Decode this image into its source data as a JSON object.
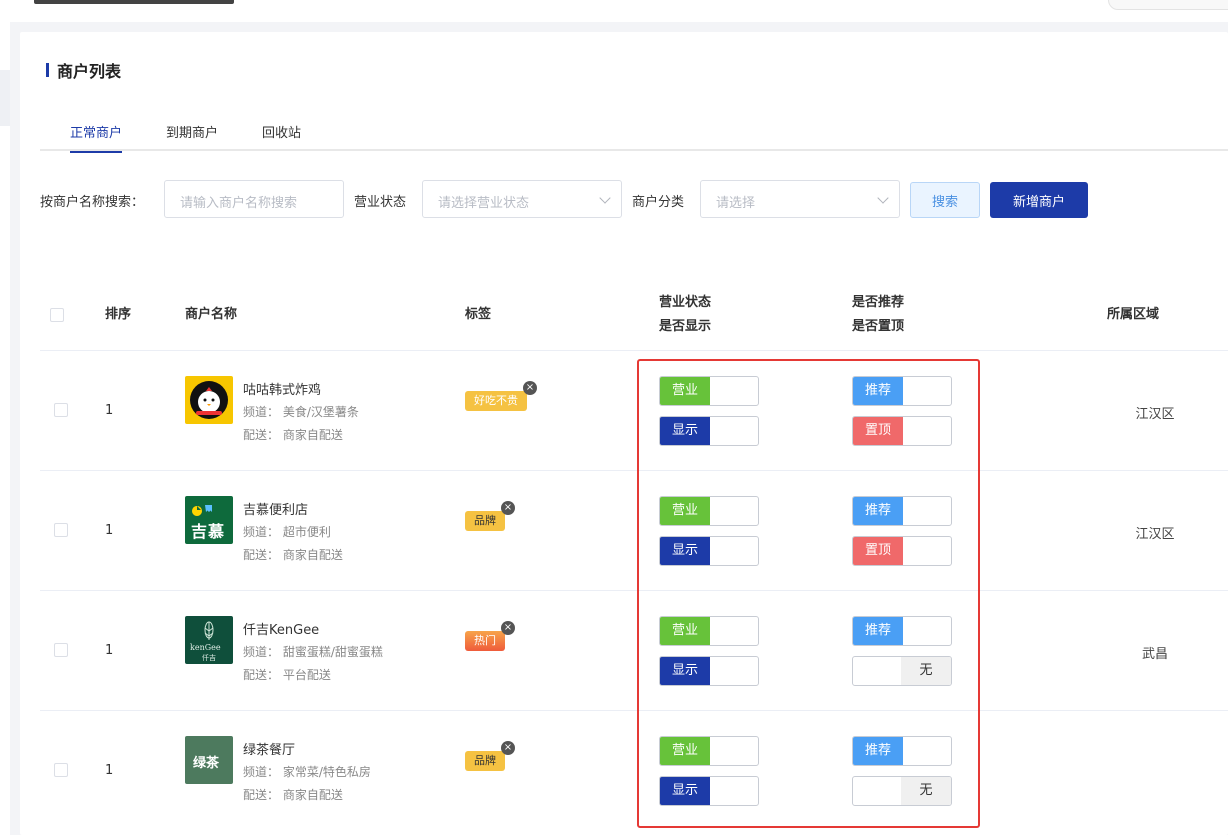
{
  "card": {
    "title": "商户列表"
  },
  "tabs": [
    {
      "label": "正常商户",
      "active": true
    },
    {
      "label": "到期商户",
      "active": false
    },
    {
      "label": "回收站",
      "active": false
    }
  ],
  "search": {
    "name_label": "按商户名称搜索：",
    "name_placeholder": "请输入商户名称搜索",
    "status_label": "营业状态",
    "status_placeholder": "请选择营业状态",
    "category_label": "商户分类",
    "category_placeholder": "请选择",
    "search_button": "搜索",
    "add_button": "新增商户"
  },
  "table": {
    "headers": {
      "sort": "排序",
      "name": "商户名称",
      "tag": "标签",
      "status_line1": "营业状态",
      "status_line2": "是否显示",
      "rec_line1": "是否推荐",
      "rec_line2": "是否置顶",
      "area": "所属区域"
    },
    "rows": [
      {
        "sort": "1",
        "name": "咕咕韩式炸鸡",
        "channel": "频道： 美食/汉堡薯条",
        "delivery": "配送： 商家自配送",
        "tag": "好吃不贵",
        "tag_style": "yellow",
        "business": "营业",
        "display": "显示",
        "recommend": "推荐",
        "top": "置顶",
        "top_on": true,
        "area": "江汉区",
        "logo": "chicken-logo"
      },
      {
        "sort": "1",
        "name": "吉慕便利店",
        "channel": "频道： 超市便利",
        "delivery": "配送： 商家自配送",
        "tag": "品牌",
        "tag_style": "brand",
        "business": "营业",
        "display": "显示",
        "recommend": "推荐",
        "top": "置顶",
        "top_on": true,
        "area": "江汉区",
        "logo": "jimu-logo"
      },
      {
        "sort": "1",
        "name": "仟吉KenGee",
        "channel": "频道： 甜蜜蛋糕/甜蜜蛋糕",
        "delivery": "配送： 平台配送",
        "tag": "热门",
        "tag_style": "hot",
        "business": "营业",
        "display": "显示",
        "recommend": "推荐",
        "top": "无",
        "top_on": false,
        "area": "武昌",
        "logo": "kengee-logo"
      },
      {
        "sort": "1",
        "name": "绿茶餐厅",
        "channel": "频道： 家常菜/特色私房",
        "delivery": "配送： 商家自配送",
        "tag": "品牌",
        "tag_style": "brand",
        "business": "营业",
        "display": "显示",
        "recommend": "推荐",
        "top": "无",
        "top_on": false,
        "area": "",
        "logo": "greentea-logo"
      }
    ]
  },
  "logos": {
    "jimu_text": "吉慕",
    "kengee_text": "kenGee",
    "kengee_cn": "仟吉",
    "greentea_text": "绿茶"
  },
  "colors": {
    "primary": "#1d3ba8",
    "business_on": "#67c23a",
    "recommend_on": "#4a9ff5",
    "top_on": "#f0696a",
    "highlight": "#e53935"
  }
}
